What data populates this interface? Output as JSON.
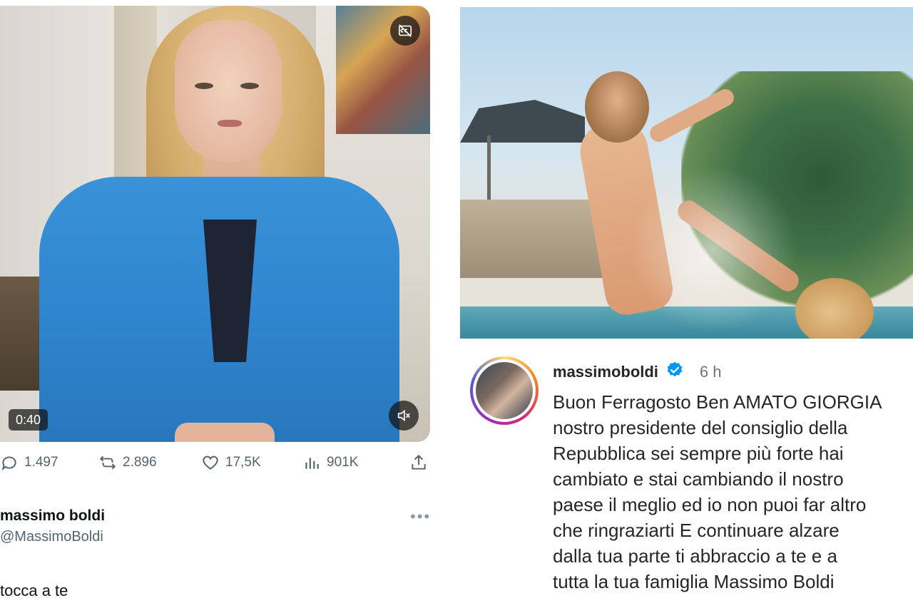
{
  "tweet": {
    "video": {
      "duration": "0:40",
      "cc_icon": "captions-off-icon",
      "mute_icon": "volume-muted-icon"
    },
    "metrics": {
      "replies": "1.497",
      "reposts": "2.896",
      "likes": "17,5K",
      "views": "901K"
    },
    "author": {
      "name": "massimo boldi",
      "handle": "@MassimoBoldi"
    },
    "text": "tocca a te"
  },
  "instagram": {
    "username": "massimoboldi",
    "verified": true,
    "time": "6 h",
    "caption_lines": [
      "Buon Ferragosto Ben AMATO GIORGIA",
      "nostro presidente del consiglio della",
      "Repubblica sei sempre più forte hai",
      "cambiato e stai cambiando il nostro",
      "paese il meglio ed io non puoi far altro",
      "che ringraziarti E continuare alzare",
      "dalla tua parte ti abbraccio a te e a",
      "tutta la tua famiglia Massimo Boldi"
    ]
  },
  "colors": {
    "x_secondary": "#536471",
    "ig_verified": "#0095f6",
    "text_primary": "#0f1419"
  }
}
